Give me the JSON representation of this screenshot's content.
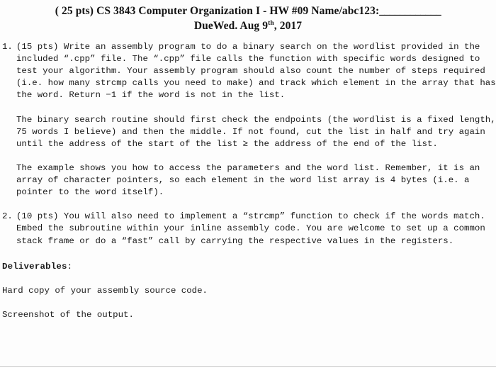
{
  "header": {
    "points": "( 25 pts)",
    "course": "CS 3843 Computer Organization I",
    "separator": "-",
    "assignment": "HW #09",
    "name_field_label": "Name/abc123:",
    "name_field_blank": "____________",
    "line1_full": "( 25 pts) CS 3843 Computer Organization I - HW #09 Name/abc123:____________",
    "due_prefix": "DueWed. Aug 9",
    "due_superscript": "th",
    "due_suffix": ", 2017",
    "line2_full": "DueWed. Aug 9th, 2017"
  },
  "items": [
    {
      "number": "1.",
      "paragraphs": [
        "(15 pts) Write an assembly program to do a binary search on the wordlist provided in the included “.cpp” file. The “.cpp” file calls the function with specific words designed to test your algorithm. Your assembly program should also count the number of steps required (i.e. how many strcmp calls you need to make) and track which element in the array that has the word. Return −1 if the word is not in the list.",
        "The binary search routine should first check the endpoints (the wordlist is a fixed length, 75 words I believe) and then the middle. If not found, cut the list in half and try again until the address of the start of the list ≥ the address of the end of the list.",
        "The example shows you how to access the parameters and the word list. Remember, it is an array of character pointers, so each element in the word list array is 4 bytes (i.e. a pointer to the word itself)."
      ]
    },
    {
      "number": "2.",
      "paragraphs": [
        "(10 pts) You will also need to implement a “strcmp” function to check if the words match. Embed the subroutine within your inline assembly code. You are welcome to set up a common stack frame or do a “fast” call by carrying the respective values in the registers."
      ]
    }
  ],
  "deliverables": {
    "heading": "Deliverables",
    "heading_colon": ":",
    "lines": [
      "Hard copy of your assembly source code.",
      "Screenshot of the output."
    ]
  }
}
